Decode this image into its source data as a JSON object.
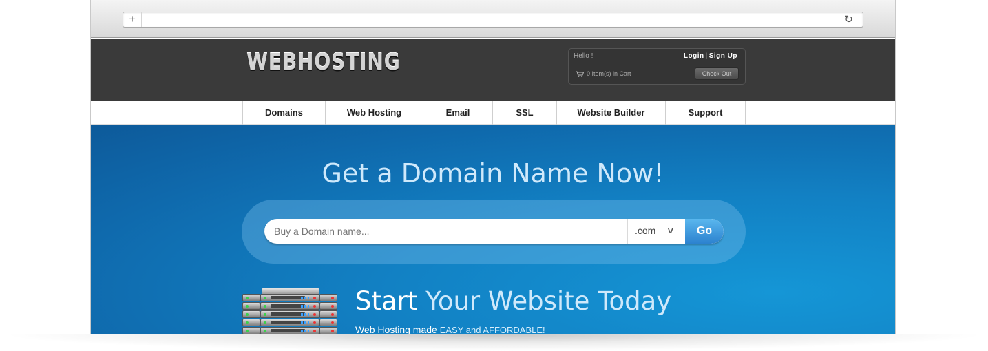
{
  "browser": {
    "new_tab_icon": "plus-icon",
    "url": "",
    "reload_icon": "reload-icon"
  },
  "header": {
    "logo": "WEBHOSTING",
    "account": {
      "greeting": "Hello !",
      "login": "Login",
      "signup": "Sign Up",
      "separator": "|",
      "cart_text": "0 Item(s) in Cart",
      "cart_icon": "cart-icon",
      "checkout": "Check Out"
    }
  },
  "nav": {
    "items": [
      {
        "label": "Domains"
      },
      {
        "label": "Web Hosting"
      },
      {
        "label": "Email"
      },
      {
        "label": "SSL"
      },
      {
        "label": "Website Builder"
      },
      {
        "label": "Support"
      }
    ]
  },
  "hero": {
    "title": "Get a Domain Name Now!",
    "search": {
      "placeholder": "Buy a Domain name...",
      "tld": ".com",
      "go": "Go"
    },
    "tagline": {
      "strong": "Start",
      "rest": " Your Website Today",
      "sub_strong": "Web Hosting made ",
      "sub_light": "EASY and AFFORDABLE!"
    }
  },
  "colors": {
    "header_bg": "#3a3a3a",
    "hero_bg": "#1281c4",
    "go_button": "#2c82cf"
  }
}
